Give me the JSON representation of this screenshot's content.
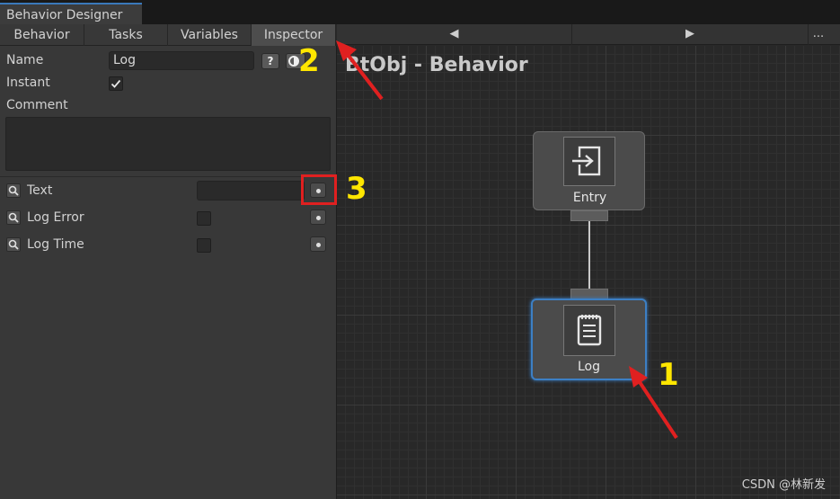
{
  "window": {
    "title": "Behavior Designer"
  },
  "tabs": [
    {
      "label": "Behavior",
      "active": false
    },
    {
      "label": "Tasks",
      "active": false
    },
    {
      "label": "Variables",
      "active": false
    },
    {
      "label": "Inspector",
      "active": true
    }
  ],
  "nav": {
    "prev": "◀",
    "next": "▶",
    "more": "..."
  },
  "inspector": {
    "name_label": "Name",
    "name_value": "Log",
    "help_label": "?",
    "instant_label": "Instant",
    "instant_checked": true,
    "comment_label": "Comment",
    "comment_value": "",
    "fields": [
      {
        "label": "Text",
        "type": "text",
        "value": ""
      },
      {
        "label": "Log Error",
        "type": "checkbox",
        "checked": false
      },
      {
        "label": "Log Time",
        "type": "checkbox",
        "checked": false
      }
    ]
  },
  "graph": {
    "title": "BtObj - Behavior",
    "nodes": [
      {
        "label": "Entry",
        "icon": "entry-icon",
        "selected": false
      },
      {
        "label": "Log",
        "icon": "notepad-icon",
        "selected": true
      }
    ]
  },
  "annotations": {
    "marker_1": "1",
    "marker_2": "2",
    "marker_3": "3",
    "color": "#ffe600",
    "arrow_color": "#e02020"
  },
  "watermark": "CSDN @林新发",
  "colors": {
    "accent": "#3a79bb",
    "selection": "#3c7fc4"
  }
}
